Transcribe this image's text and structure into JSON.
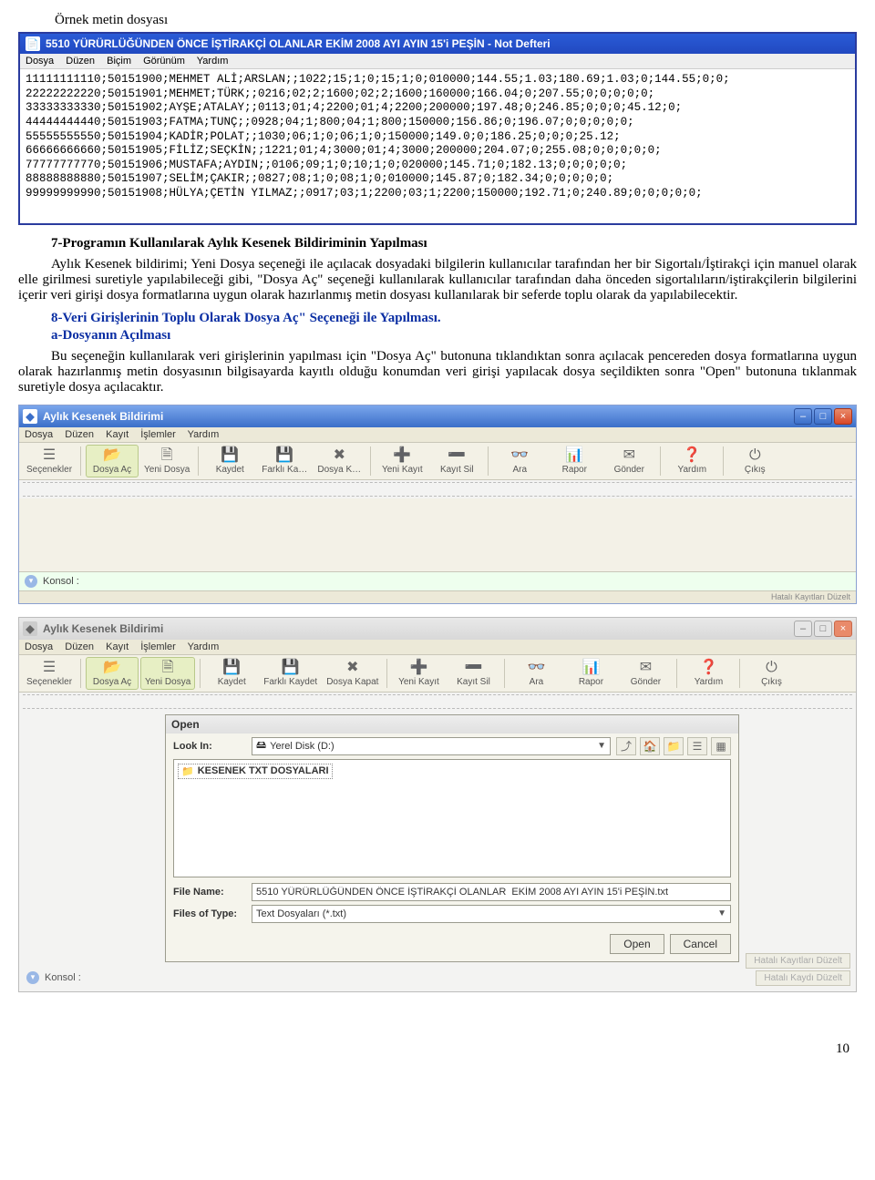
{
  "caption_example_file": "Örnek metin dosyası",
  "notepad": {
    "title": "5510 YÜRÜRLÜĞÜNDEN ÖNCE İŞTİRAKÇİ OLANLAR  EKİM 2008 AYI AYIN 15'i PEŞİN - Not Defteri",
    "menu": {
      "dosya": "Dosya",
      "duzen": "Düzen",
      "bicim": "Biçim",
      "gorunum": "Görünüm",
      "yardim": "Yardım"
    },
    "lines": [
      "11111111110;50151900;MEHMET ALİ;ARSLAN;;1022;15;1;0;15;1;0;010000;144.55;1.03;180.69;1.03;0;144.55;0;0;",
      "22222222220;50151901;MEHMET;TÜRK;;0216;02;2;1600;02;2;1600;160000;166.04;0;207.55;0;0;0;0;0;",
      "33333333330;50151902;AYŞE;ATALAY;;0113;01;4;2200;01;4;2200;200000;197.48;0;246.85;0;0;0;45.12;0;",
      "44444444440;50151903;FATMA;TUNÇ;;0928;04;1;800;04;1;800;150000;156.86;0;196.07;0;0;0;0;0;",
      "55555555550;50151904;KADİR;POLAT;;1030;06;1;0;06;1;0;150000;149.0;0;186.25;0;0;0;25.12;",
      "66666666660;50151905;FİLİZ;SEÇKİN;;1221;01;4;3000;01;4;3000;200000;204.07;0;255.08;0;0;0;0;0;",
      "77777777770;50151906;MUSTAFA;AYDIN;;0106;09;1;0;10;1;0;020000;145.71;0;182.13;0;0;0;0;0;",
      "88888888880;50151907;SELİM;ÇAKIR;;0827;08;1;0;08;1;0;010000;145.87;0;182.34;0;0;0;0;0;",
      "99999999990;50151908;HÜLYA;ÇETİN YILMAZ;;0917;03;1;2200;03;1;2200;150000;192.71;0;240.89;0;0;0;0;0;"
    ]
  },
  "section7": {
    "title": "7-Programın Kullanılarak Aylık Kesenek Bildiriminin Yapılması",
    "para": "Aylık Kesenek bildirimi; Yeni Dosya seçeneği ile açılacak dosyadaki bilgilerin kullanıcılar tarafından her bir Sigortalı/İştirakçi için manuel olarak elle girilmesi suretiyle yapılabileceği gibi, \"Dosya Aç\" seçeneği kullanılarak kullanıcılar tarafından daha önceden sigortalıların/iştirakçilerin bilgilerini içerir veri girişi dosya formatlarına uygun olarak hazırlanmış metin dosyası kullanılarak bir seferde toplu olarak da yapılabilecektir."
  },
  "section8": {
    "title": "8-Veri Girişlerinin Toplu Olarak Dosya Aç\" Seçeneği ile Yapılması.",
    "a_title": "a-Dosyanın Açılması",
    "a_para": "Bu seçeneğin kullanılarak veri girişlerinin yapılması için \"Dosya Aç\" butonuna tıklandıktan sonra açılacak pencereden dosya formatlarına uygun olarak hazırlanmış metin dosyasının bilgisayarda kayıtlı olduğu konumdan veri girişi yapılacak dosya seçildikten sonra \"Open\" butonuna tıklanmak suretiyle dosya açılacaktır."
  },
  "app": {
    "title": "Aylık Kesenek Bildirimi",
    "menu": {
      "dosya": "Dosya",
      "duzen": "Düzen",
      "kayit": "Kayıt",
      "islemler": "İşlemler",
      "yardim": "Yardım"
    },
    "toolbar": {
      "secenekler": "Seçenekler",
      "dosya_ac": "Dosya Aç",
      "yeni_dosya": "Yeni Dosya",
      "kaydet": "Kaydet",
      "farkli_kaydet": "Farklı Ka…",
      "dosya_kapat": "Dosya K…",
      "yeni_kayit": "Yeni Kayıt",
      "kayit_sil": "Kayıt Sil",
      "ara": "Ara",
      "rapor": "Rapor",
      "gonder": "Gönder",
      "yardim": "Yardım",
      "cikis": "Çıkış"
    },
    "konsol": "Konsol :",
    "status_hint": "Hatalı Kayıtları Düzelt"
  },
  "app2": {
    "title": "Aylık Kesenek Bildirimi",
    "toolbar": {
      "secenekler": "Seçenekler",
      "dosya_ac": "Dosya Aç",
      "yeni_dosya": "Yeni Dosya",
      "kaydet": "Kaydet",
      "farkli_kaydet": "Farklı Kaydet",
      "dosya_kapat": "Dosya Kapat",
      "yeni_kayit": "Yeni Kayıt",
      "kayit_sil": "Kayıt Sil",
      "ara": "Ara",
      "rapor": "Rapor",
      "gonder": "Gönder",
      "yardim": "Yardım",
      "cikis": "Çıkış"
    },
    "status_btn1": "Hatalı Kayıtları Düzelt",
    "status_btn2": "Hatalı Kaydı Düzelt"
  },
  "open_dialog": {
    "title": "Open",
    "look_in_label": "Look In:",
    "look_in_value": "Yerel Disk (D:)",
    "folder_name": "KESENEK TXT DOSYALARI",
    "file_name_label": "File Name:",
    "file_name_value": "5510 YÜRÜRLÜĞÜNDEN ÖNCE İŞTİRAKÇİ OLANLAR  EKİM 2008 AYI AYIN 15'i PEŞİN.txt",
    "file_type_label": "Files of Type:",
    "file_type_value": "Text Dosyaları (*.txt)",
    "open_btn": "Open",
    "cancel_btn": "Cancel"
  },
  "page_number": "10"
}
